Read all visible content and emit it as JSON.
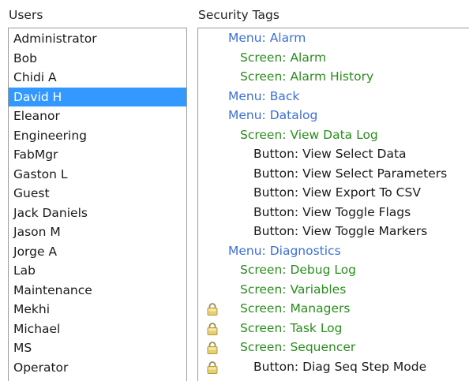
{
  "users_heading": "Users",
  "tags_heading": "Security Tags",
  "users": [
    {
      "label": "Administrator",
      "selected": false
    },
    {
      "label": "Bob",
      "selected": false
    },
    {
      "label": "Chidi A",
      "selected": false
    },
    {
      "label": "David H",
      "selected": true
    },
    {
      "label": "Eleanor",
      "selected": false
    },
    {
      "label": "Engineering",
      "selected": false
    },
    {
      "label": "FabMgr",
      "selected": false
    },
    {
      "label": "Gaston L",
      "selected": false
    },
    {
      "label": "Guest",
      "selected": false
    },
    {
      "label": "Jack Daniels",
      "selected": false
    },
    {
      "label": "Jason M",
      "selected": false
    },
    {
      "label": "Jorge A",
      "selected": false
    },
    {
      "label": "Lab",
      "selected": false
    },
    {
      "label": "Maintenance",
      "selected": false
    },
    {
      "label": "Mekhi",
      "selected": false
    },
    {
      "label": "Michael",
      "selected": false
    },
    {
      "label": "MS",
      "selected": false
    },
    {
      "label": "Operator",
      "selected": false
    }
  ],
  "tags": [
    {
      "label": "Menu: Alarm",
      "level": 0,
      "locked": false
    },
    {
      "label": "Screen: Alarm",
      "level": 1,
      "locked": false
    },
    {
      "label": "Screen: Alarm History",
      "level": 1,
      "locked": false
    },
    {
      "label": "Menu: Back",
      "level": 0,
      "locked": false
    },
    {
      "label": "Menu: Datalog",
      "level": 0,
      "locked": false
    },
    {
      "label": "Screen: View Data Log",
      "level": 1,
      "locked": false
    },
    {
      "label": "Button: View Select Data",
      "level": 2,
      "locked": false
    },
    {
      "label": "Button: View Select Parameters",
      "level": 2,
      "locked": false
    },
    {
      "label": "Button: View Export To CSV",
      "level": 2,
      "locked": false
    },
    {
      "label": "Button: View Toggle Flags",
      "level": 2,
      "locked": false
    },
    {
      "label": "Button: View Toggle Markers",
      "level": 2,
      "locked": false
    },
    {
      "label": "Menu: Diagnostics",
      "level": 0,
      "locked": false
    },
    {
      "label": "Screen: Debug Log",
      "level": 1,
      "locked": false
    },
    {
      "label": "Screen: Variables",
      "level": 1,
      "locked": false
    },
    {
      "label": "Screen: Managers",
      "level": 1,
      "locked": true
    },
    {
      "label": "Screen: Task Log",
      "level": 1,
      "locked": true
    },
    {
      "label": "Screen: Sequencer",
      "level": 1,
      "locked": true
    },
    {
      "label": "Button: Diag Seq Step Mode",
      "level": 2,
      "locked": true
    }
  ],
  "colors": {
    "selection": "#3399ff",
    "menu_tag": "#3c6fd6",
    "screen_tag": "#2a8d1d",
    "button_tag": "#1a1a1a"
  },
  "lock_icon": "padlock-icon"
}
